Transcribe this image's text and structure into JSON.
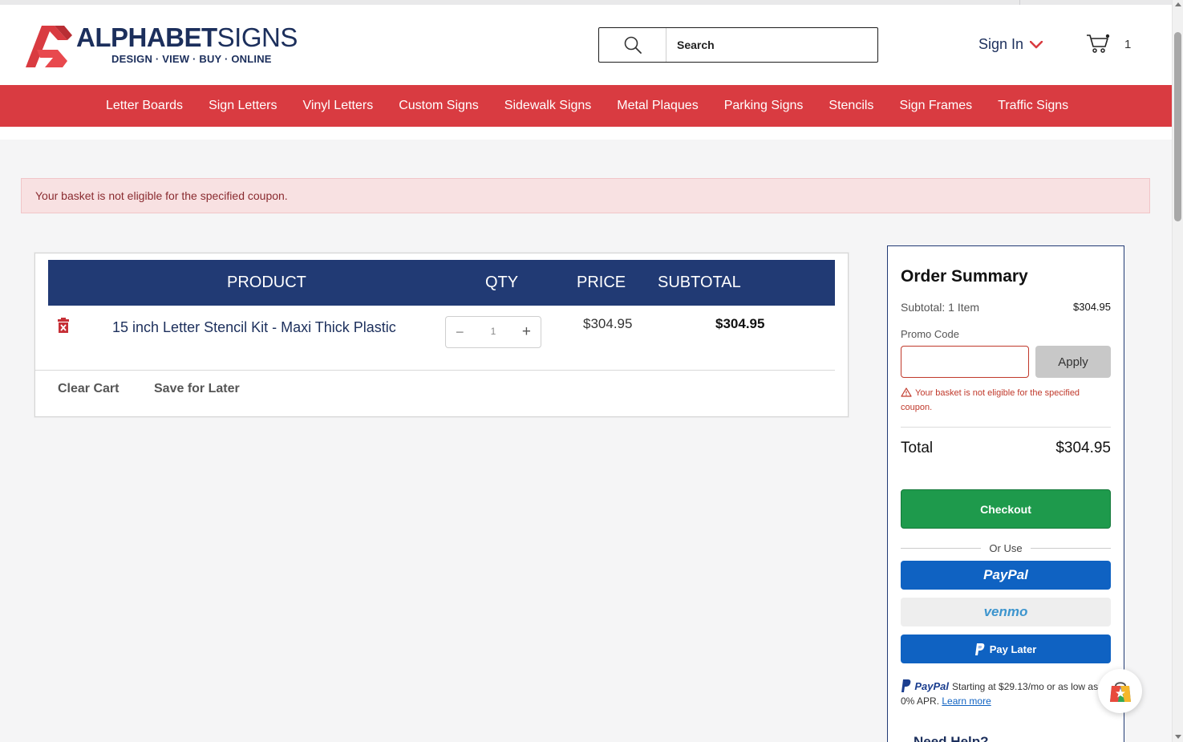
{
  "brand": {
    "name_bold": "ALPHABET",
    "name_thin": "SIGNS",
    "tagline": "DESIGN · VIEW · BUY · ONLINE",
    "colors": {
      "navy": "#1c2f5c",
      "red": "#d93b41"
    }
  },
  "header": {
    "search_placeholder": "Search",
    "sign_in": "Sign In",
    "cart_count": "1"
  },
  "nav": {
    "items": [
      "Letter Boards",
      "Sign Letters",
      "Vinyl Letters",
      "Custom Signs",
      "Sidewalk Signs",
      "Metal Plaques",
      "Parking Signs",
      "Stencils",
      "Sign Frames",
      "Traffic Signs"
    ]
  },
  "alert": {
    "message": "Your basket is not eligible for the specified coupon."
  },
  "cart": {
    "columns": {
      "product": "PRODUCT",
      "qty": "QTY",
      "price": "PRICE",
      "subtotal": "SUBTOTAL"
    },
    "items": [
      {
        "name": "15 inch Letter Stencil Kit - Maxi Thick Plastic",
        "qty": "1",
        "price": "$304.95",
        "subtotal": "$304.95"
      }
    ],
    "clear_cart": "Clear Cart",
    "save_for_later": "Save for Later"
  },
  "summary": {
    "title": "Order Summary",
    "subtotal_label": "Subtotal: 1 Item",
    "subtotal_value": "$304.95",
    "promo_label": "Promo Code",
    "promo_value": "",
    "apply": "Apply",
    "promo_error": "Your basket is not eligible for the specified coupon.",
    "total_label": "Total",
    "total_value": "$304.95",
    "checkout": "Checkout",
    "or_use": "Or Use",
    "paypal": "PayPal",
    "venmo": "venmo",
    "pay_later": "Pay Later",
    "paypal_msg_brand": "PayPal",
    "paypal_msg_text": "Starting at $29.13/mo or as low as",
    "paypal_msg_apr": "0% APR.",
    "learn_more": "Learn more",
    "need_help": "Need Help?"
  }
}
